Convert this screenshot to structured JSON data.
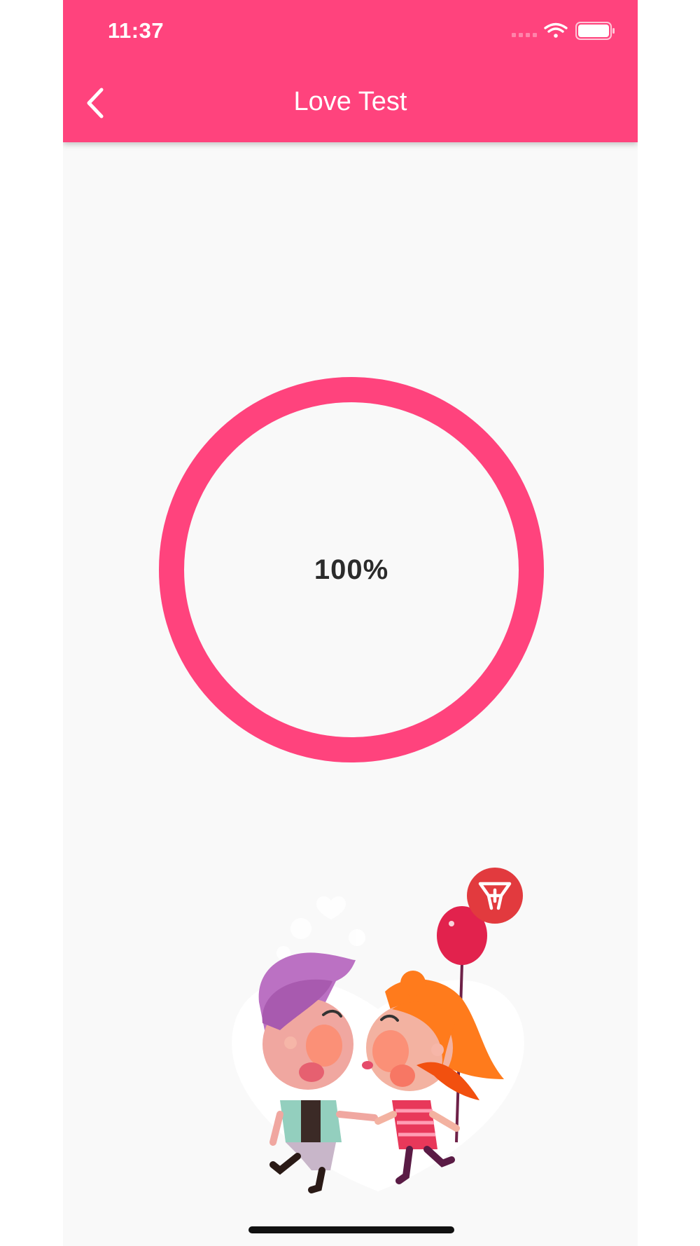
{
  "status_bar": {
    "time": "11:37"
  },
  "app_bar": {
    "title": "Love Test",
    "back_icon": "chevron-left-icon"
  },
  "result": {
    "percent_text": "100%",
    "progress": 1.0
  },
  "colors": {
    "accent": "#ff437d",
    "background": "#f9f9f9",
    "badge": "#e23a3e"
  }
}
